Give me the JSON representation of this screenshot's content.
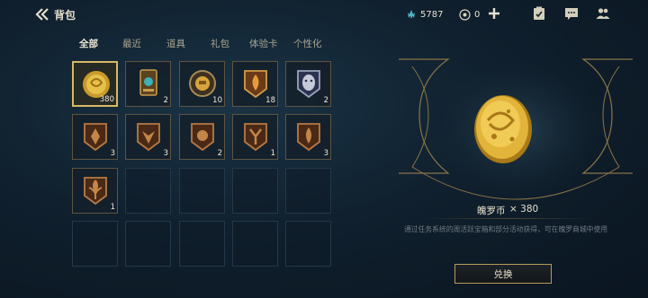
{
  "header": {
    "title": "背包",
    "currency_blue": "5787",
    "currency_token": "0"
  },
  "tabs": [
    {
      "label": "全部",
      "active": true
    },
    {
      "label": "最近"
    },
    {
      "label": "道具"
    },
    {
      "label": "礼包"
    },
    {
      "label": "体验卡"
    },
    {
      "label": "个性化"
    }
  ],
  "items": [
    {
      "icon": "coin-icon",
      "count": "380",
      "selected": true
    },
    {
      "icon": "scroll-card-icon",
      "count": "2"
    },
    {
      "icon": "gold-token-icon",
      "count": "10"
    },
    {
      "icon": "flame-emblem-icon",
      "count": "18"
    },
    {
      "icon": "mask-emblem-icon",
      "count": "2"
    },
    {
      "icon": "bronze-emblem-icon",
      "count": "3"
    },
    {
      "icon": "bronze-emblem-icon",
      "count": "3"
    },
    {
      "icon": "bronze-emblem-icon",
      "count": "2"
    },
    {
      "icon": "bronze-emblem-icon",
      "count": "1"
    },
    {
      "icon": "bronze-emblem-icon",
      "count": "3"
    },
    {
      "icon": "fleur-emblem-icon",
      "count": "1"
    }
  ],
  "detail": {
    "name": "魄罗币",
    "quantity": "× 380",
    "description": "通过任务系统的周活跃宝箱和部分活动获得，可在魄罗商城中使用",
    "button": "兑换"
  },
  "colors": {
    "accent": "#d7b964",
    "background": "#10202e"
  }
}
